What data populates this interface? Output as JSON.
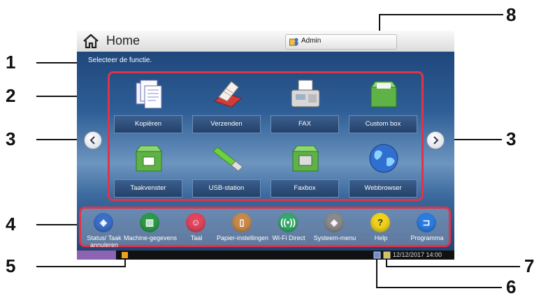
{
  "header": {
    "title": "Home",
    "user_label": "Admin"
  },
  "prompt": "Selecteer de functie.",
  "functions": [
    {
      "label": "Kopiëren",
      "icon": "copy-icon"
    },
    {
      "label": "Verzenden",
      "icon": "send-icon"
    },
    {
      "label": "FAX",
      "icon": "fax-icon"
    },
    {
      "label": "Custom box",
      "icon": "custom-box-icon"
    },
    {
      "label": "Taakvenster",
      "icon": "job-box-icon"
    },
    {
      "label": "USB-station",
      "icon": "usb-drive-icon"
    },
    {
      "label": "Faxbox",
      "icon": "fax-box-icon"
    },
    {
      "label": "Webbrowser",
      "icon": "web-browser-icon"
    }
  ],
  "tasks": [
    {
      "label": "Status/ Taak annuleren",
      "icon": "status-icon",
      "color": "#3b6fc8"
    },
    {
      "label": "Machine-gegevens",
      "icon": "machine-info-icon",
      "color": "#2c9a4a"
    },
    {
      "label": "Taal",
      "icon": "language-icon",
      "color": "#e0455d"
    },
    {
      "label": "Papier-instellingen",
      "icon": "paper-settings-icon",
      "color": "#c88a4a"
    },
    {
      "label": "Wi-Fi Direct",
      "icon": "wifi-direct-icon",
      "color": "#35a86a"
    },
    {
      "label": "Systeem-menu",
      "icon": "system-menu-icon",
      "color": "#8a8a8a"
    },
    {
      "label": "Help",
      "icon": "help-icon",
      "color": "#f0d21a"
    },
    {
      "label": "Programma",
      "icon": "program-icon",
      "color": "#2c7ce0"
    }
  ],
  "status_bar": {
    "datetime": "12/12/2017 14:00"
  },
  "callouts": [
    "1",
    "2",
    "3",
    "3",
    "4",
    "5",
    "6",
    "7",
    "8"
  ],
  "colors": {
    "highlight": "#e0334a",
    "screen_bg": "#2d5e96",
    "tile_label_bg": "#2e5080"
  }
}
